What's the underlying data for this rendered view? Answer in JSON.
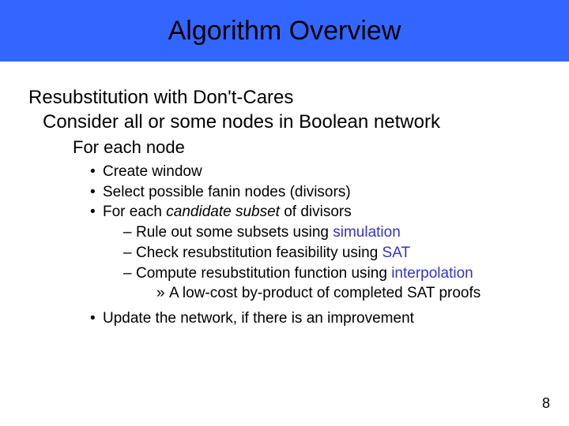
{
  "slide": {
    "title": "Algorithm Overview",
    "heading": "Resubstitution with Don't-Cares",
    "sub1": "Consider all or some nodes in Boolean network",
    "sub2": "For each node",
    "bullets": {
      "b1": "Create window",
      "b2": "Select possible fanin nodes (divisors)",
      "b3_pre": "For each ",
      "b3_em": "candidate subset",
      "b3_post": " of divisors",
      "d1_pre": "Rule out some subsets using ",
      "d1_hl": "simulation",
      "d2_pre": "Check resubstitution feasibility using ",
      "d2_hl": "SAT",
      "d3_pre": "Compute resubstitution function using ",
      "d3_hl": "interpolation",
      "d3a": "A low-cost by-product of completed SAT proofs",
      "b4": "Update the network, if there is an improvement"
    },
    "page_number": "8"
  }
}
